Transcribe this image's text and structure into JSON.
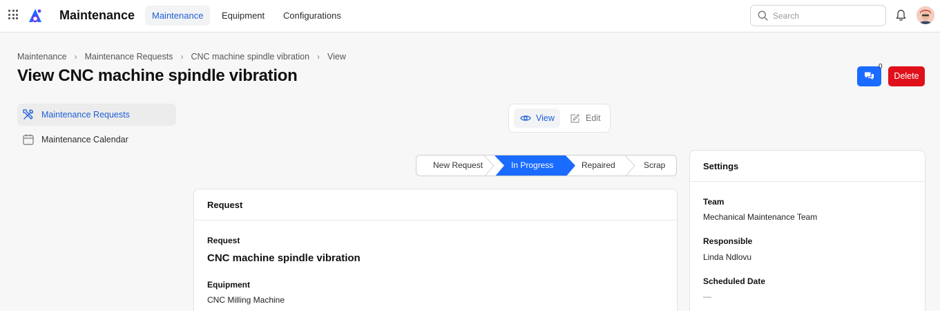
{
  "topbar": {
    "app_title": "Maintenance",
    "nav": [
      "Maintenance",
      "Equipment",
      "Configurations"
    ],
    "active_nav": "Maintenance",
    "search_placeholder": "Search"
  },
  "breadcrumb": [
    "Maintenance",
    "Maintenance Requests",
    "CNC machine spindle vibration",
    "View"
  ],
  "page_title": "View CNC machine spindle vibration",
  "actions": {
    "comments_count": "0",
    "delete_label": "Delete"
  },
  "sidebar": {
    "items": [
      {
        "label": "Maintenance Requests",
        "icon": "tools-icon",
        "active": true
      },
      {
        "label": "Maintenance Calendar",
        "icon": "calendar-icon",
        "active": false
      }
    ]
  },
  "mode_toggle": {
    "view_label": "View",
    "edit_label": "Edit",
    "active": "View"
  },
  "pipeline": {
    "stages": [
      "New Request",
      "In Progress",
      "Repaired",
      "Scrap"
    ],
    "current": "In Progress"
  },
  "request_card": {
    "title": "Request",
    "request_label": "Request",
    "request_value": "CNC machine spindle vibration",
    "equipment_label": "Equipment",
    "equipment_value": "CNC Milling Machine"
  },
  "settings_card": {
    "title": "Settings",
    "team_label": "Team",
    "team_value": "Mechanical Maintenance Team",
    "responsible_label": "Responsible",
    "responsible_value": "Linda Ndlovu",
    "scheduled_label": "Scheduled Date",
    "scheduled_value": "—"
  },
  "colors": {
    "accent": "#1a6bff",
    "danger": "#e0101a",
    "active_text": "#1f5fd6"
  }
}
